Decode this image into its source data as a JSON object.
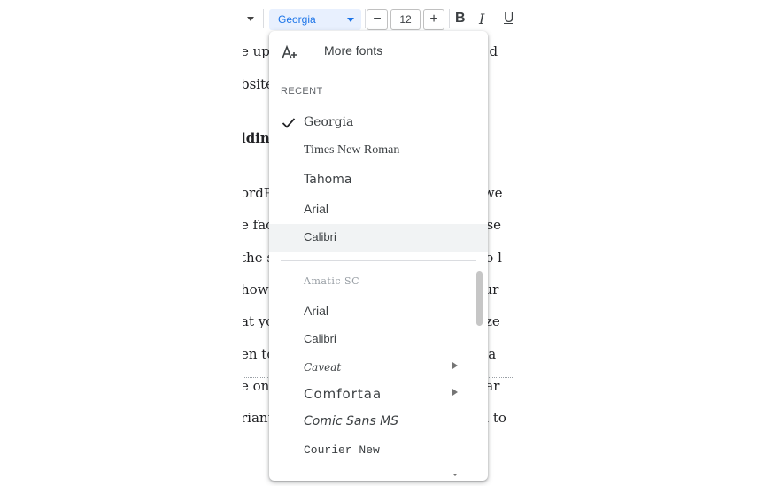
{
  "toolbar": {
    "font_name": "Georgia",
    "font_size": "12",
    "minus_label": "−",
    "plus_label": "+",
    "bold_label": "B",
    "italic_label": "I",
    "underline_label": "U"
  },
  "document": {
    "lines": [
      {
        "left": "e up",
        "right": "ou d"
      },
      {
        "left": "bsite",
        "right": ""
      },
      {
        "left": "ldin",
        "right": ""
      },
      {
        "left": "ordP",
        "right": "ir we"
      },
      {
        "left": "e fact",
        "right": "nt se"
      },
      {
        "left": "the s",
        "right": "y to l"
      },
      {
        "left": "how",
        "right": "your"
      },
      {
        "left": "at yo",
        "right": "mize"
      },
      {
        "left": "en to",
        "right": "loca"
      },
      {
        "left": "e ont",
        "right": "t var"
      },
      {
        "left": "riant",
        "right": "em to"
      }
    ]
  },
  "font_menu": {
    "more_fonts_label": "More fonts",
    "recent_header": "RECENT",
    "recent": [
      {
        "name": "Georgia",
        "selected": true
      },
      {
        "name": "Times New Roman",
        "selected": false
      },
      {
        "name": "Tahoma",
        "selected": false
      },
      {
        "name": "Arial",
        "selected": false
      },
      {
        "name": "Calibri",
        "selected": false,
        "hovered": true
      }
    ],
    "all_fonts": [
      {
        "name": "Amatic SC",
        "has_submenu": false
      },
      {
        "name": "Arial",
        "has_submenu": false
      },
      {
        "name": "Calibri",
        "has_submenu": false
      },
      {
        "name": "Caveat",
        "has_submenu": true
      },
      {
        "name": "Comfortaa",
        "has_submenu": true
      },
      {
        "name": "Comic Sans MS",
        "has_submenu": false
      },
      {
        "name": "Courier New",
        "has_submenu": false
      }
    ]
  },
  "colors": {
    "accent": "#1a73e8",
    "selected_bg": "#e8f0fe",
    "hover_bg": "#f1f3f4",
    "text": "#3c4043"
  }
}
